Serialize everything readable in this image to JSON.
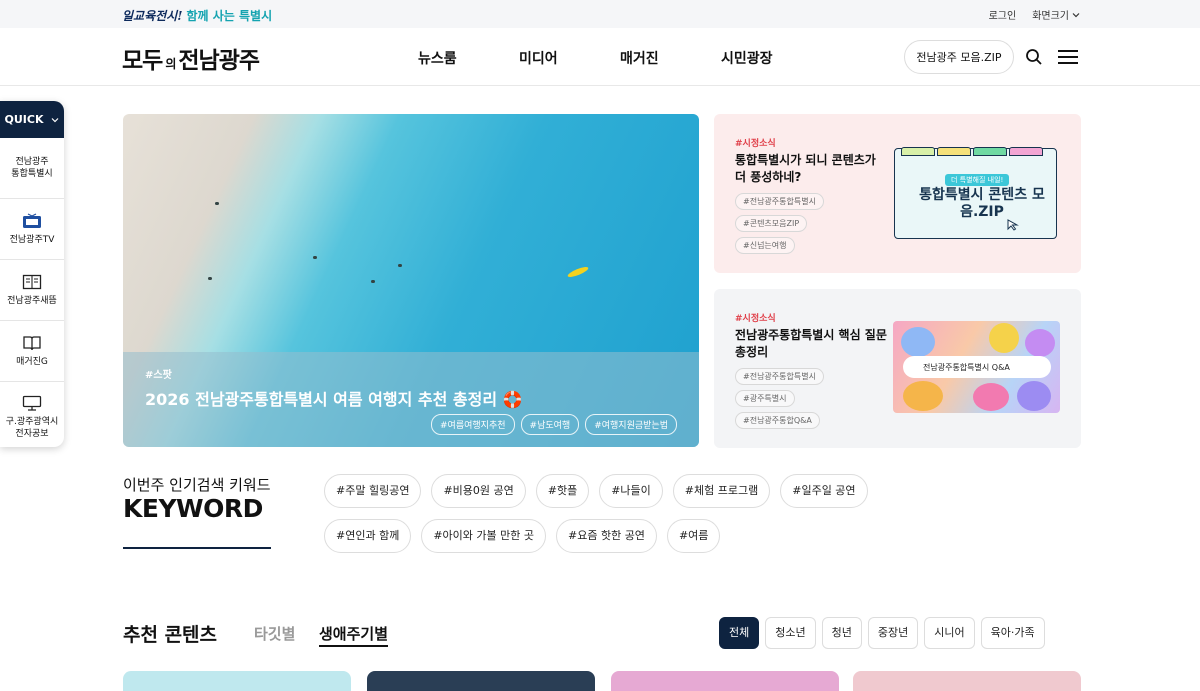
{
  "top_bar": {
    "slogan_script": "일교육전시!",
    "slogan_main": "함께 사는 특별시",
    "login": "로그인",
    "zoom": "화면크기"
  },
  "header": {
    "logo_a": "모두",
    "logo_b": "의",
    "logo_c": "전남광주",
    "nav": [
      "뉴스룸",
      "미디어",
      "매거진",
      "시민광장"
    ],
    "zip_button": "전남광주 모음.ZIP"
  },
  "quick": {
    "title": "QUICK",
    "items": [
      {
        "label": "전남광주\n통합특별시",
        "icon": "none"
      },
      {
        "label": "전남광주TV",
        "icon": "tv-icon"
      },
      {
        "label": "전남광주새뜸",
        "icon": "book-icon"
      },
      {
        "label": "매거진G",
        "icon": "open-book-icon"
      },
      {
        "label": "구.광주광역시\n전자공보",
        "icon": "monitor-icon"
      }
    ]
  },
  "hero": {
    "tag": "#스팟",
    "title": "2026 전남광주통합특별시 여름 여행지 추천 총정리 🛟",
    "chips": [
      "#여름여행지추천",
      "#남도여행",
      "#여행지원금받는법"
    ]
  },
  "cards": [
    {
      "tag": "#시정소식",
      "title": "통합특별시가 되니 콘텐츠가 더 풍성하네?",
      "chips": [
        "#전남광주통합특별시",
        "#콘텐츠모음ZIP",
        "#신넘는여행"
      ],
      "thumb_mini": "더 특별해질 내일!",
      "thumb_big": "통합특별시 콘텐츠 모음.ZIP"
    },
    {
      "tag": "#시정소식",
      "title": "전남광주통합특별시 핵심 질문 총정리",
      "chips": [
        "#전남광주통합특별시",
        "#광주특별시",
        "#전남광주통합Q&A"
      ],
      "thumb_search": "전남광주통합특별시 Q&A"
    }
  ],
  "keyword": {
    "small": "이번주 인기검색 키워드",
    "big": "KEYWORD",
    "tags": [
      "#주말 힐링공연",
      "#비용0원 공연",
      "#핫플",
      "#나들이",
      "#체험 프로그램",
      "#일주일 공연",
      "#연인과 함께",
      "#아이와 가볼 만한 곳",
      "#요즘 핫한 공연",
      "#여름"
    ]
  },
  "recommend": {
    "title": "추천 콘텐츠",
    "tab_target": "타깃별",
    "tab_life": "생애주기별",
    "filters": [
      "전체",
      "청소년",
      "청년",
      "중장년",
      "시니어",
      "육아·가족"
    ]
  },
  "colors": {
    "navy": "#0e2340",
    "accent_red": "#e0404a",
    "slogan_teal": "#14a3b0"
  }
}
